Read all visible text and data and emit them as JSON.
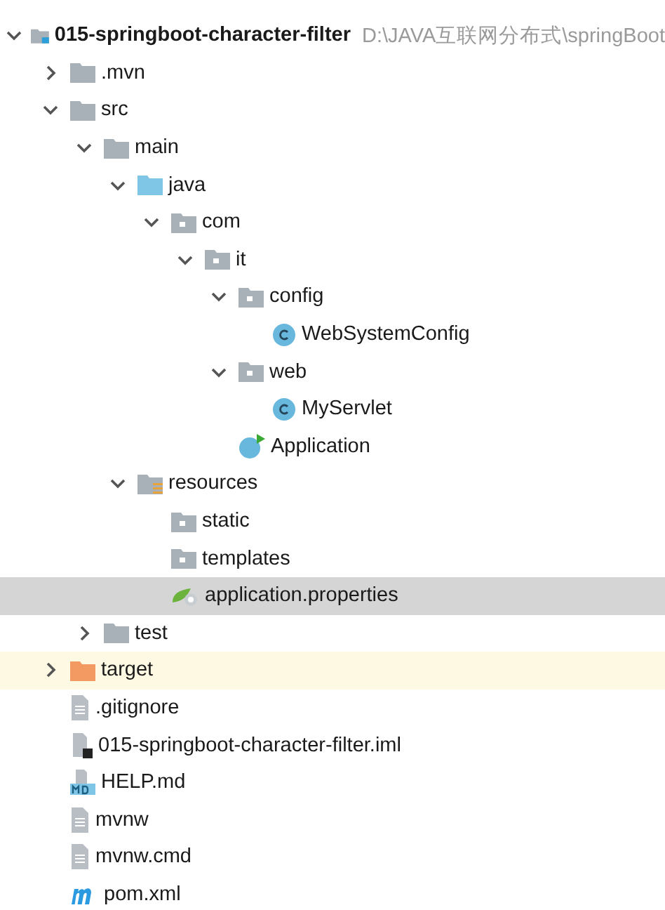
{
  "project_tree": [
    {
      "name": "015-springboot-character-filter",
      "path": "D:\\JAVA互联网分布式\\springBoot",
      "kind": "module",
      "expanded": true,
      "selected": false,
      "children": [
        {
          "name": ".mvn",
          "kind": "folder",
          "expanded": false,
          "selected": false
        },
        {
          "name": "src",
          "kind": "folder",
          "expanded": true,
          "selected": false,
          "children": [
            {
              "name": "main",
              "kind": "folder",
              "expanded": true,
              "selected": false,
              "children": [
                {
                  "name": "java",
                  "kind": "source-folder",
                  "expanded": true,
                  "selected": false,
                  "children": [
                    {
                      "name": "com",
                      "kind": "package",
                      "expanded": true,
                      "selected": false,
                      "children": [
                        {
                          "name": "it",
                          "kind": "package",
                          "expanded": true,
                          "selected": false,
                          "children": [
                            {
                              "name": "config",
                              "kind": "package",
                              "expanded": true,
                              "selected": false,
                              "children": [
                                {
                                  "name": "WebSystemConfig",
                                  "kind": "class",
                                  "selected": false
                                }
                              ]
                            },
                            {
                              "name": "web",
                              "kind": "package",
                              "expanded": true,
                              "selected": false,
                              "children": [
                                {
                                  "name": "MyServlet",
                                  "kind": "class",
                                  "selected": false
                                }
                              ]
                            },
                            {
                              "name": "Application",
                              "kind": "spring-app",
                              "selected": false
                            }
                          ]
                        }
                      ]
                    }
                  ]
                },
                {
                  "name": "resources",
                  "kind": "resources-folder",
                  "expanded": true,
                  "selected": false,
                  "children": [
                    {
                      "name": "static",
                      "kind": "package",
                      "selected": false
                    },
                    {
                      "name": "templates",
                      "kind": "package",
                      "selected": false
                    },
                    {
                      "name": "application.properties",
                      "kind": "spring-props",
                      "selected": true
                    }
                  ]
                }
              ]
            },
            {
              "name": "test",
              "kind": "folder",
              "expanded": false,
              "selected": false
            }
          ]
        },
        {
          "name": "target",
          "kind": "excluded-folder",
          "expanded": false,
          "selected": false
        },
        {
          "name": ".gitignore",
          "kind": "file",
          "selected": false
        },
        {
          "name": "015-springboot-character-filter.iml",
          "kind": "iml",
          "selected": false
        },
        {
          "name": "HELP.md",
          "kind": "markdown",
          "selected": false
        },
        {
          "name": "mvnw",
          "kind": "file",
          "selected": false
        },
        {
          "name": "mvnw.cmd",
          "kind": "file",
          "selected": false
        },
        {
          "name": "pom.xml",
          "kind": "maven",
          "selected": false
        }
      ]
    }
  ]
}
